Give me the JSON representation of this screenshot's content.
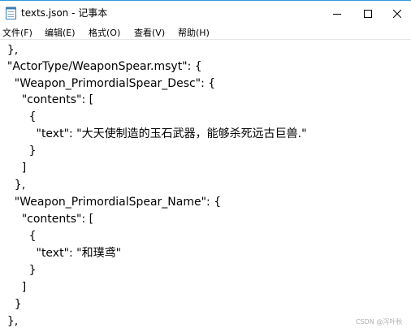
{
  "window": {
    "title": "texts.json - 记事本",
    "icon": "notepad-icon",
    "controls": [
      "minimize-icon",
      "maximize-icon",
      "close-icon"
    ]
  },
  "menu": {
    "items": [
      {
        "label": "文件(F)"
      },
      {
        "label": "编辑(E)"
      },
      {
        "label": "格式(O)"
      },
      {
        "label": "查看(V)"
      },
      {
        "label": "帮助(H)"
      }
    ]
  },
  "editor": {
    "lines": [
      "  },",
      "  \"ActorType/WeaponSpear.msyt\": {",
      "    \"Weapon_PrimordialSpear_Desc\": {",
      "      \"contents\": [",
      "        {",
      "          \"text\": \"大天使制造的玉石武器，能够杀死远古巨兽.\"",
      "        }",
      "      ]",
      "    },",
      "    \"Weapon_PrimordialSpear_Name\": {",
      "      \"contents\": [",
      "        {",
      "          \"text\": \"和璞鸢\"",
      "        }",
      "      ]",
      "    }",
      "  },"
    ]
  },
  "watermark": "CSDN @泻叶秋"
}
